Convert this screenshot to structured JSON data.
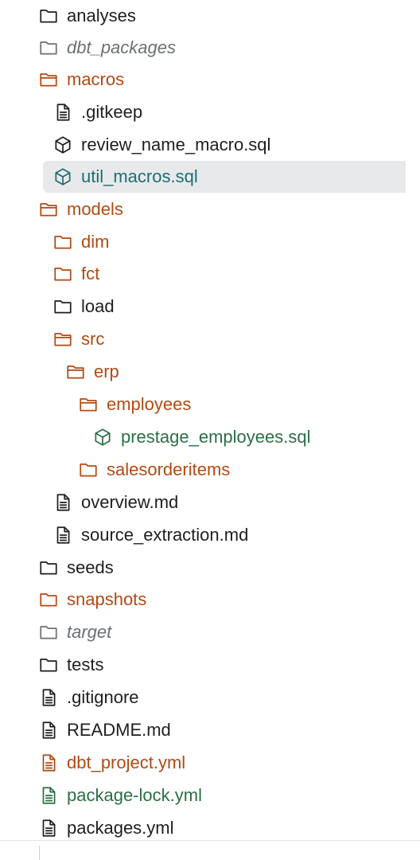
{
  "explorer": {
    "items": [
      {
        "label": "analyses",
        "type": "folder",
        "color": "default"
      },
      {
        "label": "dbt_packages",
        "type": "folder",
        "color": "grey"
      },
      {
        "label": "macros",
        "type": "folder-open",
        "color": "orange"
      },
      {
        "label": ".gitkeep",
        "type": "file",
        "color": "default"
      },
      {
        "label": "review_name_macro.sql",
        "type": "model",
        "color": "default"
      },
      {
        "label": "util_macros.sql",
        "type": "model",
        "color": "teal",
        "selected": true
      },
      {
        "label": "models",
        "type": "folder-open",
        "color": "orange"
      },
      {
        "label": "dim",
        "type": "folder",
        "color": "orange"
      },
      {
        "label": "fct",
        "type": "folder",
        "color": "orange"
      },
      {
        "label": "load",
        "type": "folder",
        "color": "default"
      },
      {
        "label": "src",
        "type": "folder-open",
        "color": "orange"
      },
      {
        "label": "erp",
        "type": "folder-open",
        "color": "orange"
      },
      {
        "label": "employees",
        "type": "folder-open",
        "color": "orange"
      },
      {
        "label": "prestage_employees.sql",
        "type": "model",
        "color": "green"
      },
      {
        "label": "salesorderitems",
        "type": "folder",
        "color": "orange"
      },
      {
        "label": "overview.md",
        "type": "file",
        "color": "default"
      },
      {
        "label": "source_extraction.md",
        "type": "file",
        "color": "default"
      },
      {
        "label": "seeds",
        "type": "folder",
        "color": "default"
      },
      {
        "label": "snapshots",
        "type": "folder",
        "color": "orange"
      },
      {
        "label": "target",
        "type": "folder",
        "color": "grey"
      },
      {
        "label": "tests",
        "type": "folder",
        "color": "default"
      },
      {
        "label": ".gitignore",
        "type": "file",
        "color": "default"
      },
      {
        "label": "README.md",
        "type": "file",
        "color": "default"
      },
      {
        "label": "dbt_project.yml",
        "type": "file",
        "color": "orange"
      },
      {
        "label": "package-lock.yml",
        "type": "file",
        "color": "green"
      },
      {
        "label": "packages.yml",
        "type": "file",
        "color": "default"
      }
    ]
  },
  "colors": {
    "default": "#1f1f1f",
    "orange": "#b14a14",
    "green": "#2b6f45",
    "teal": "#1d6e73",
    "grey": "#6b6f75",
    "selected_bg": "#e8e9eb"
  }
}
